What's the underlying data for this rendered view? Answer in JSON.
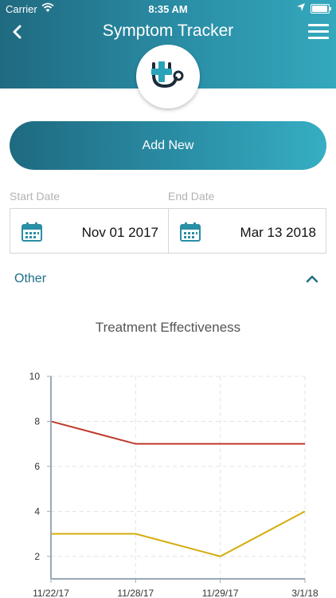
{
  "status_bar": {
    "carrier": "Carrier",
    "time": "8:35 AM"
  },
  "header": {
    "title": "Symptom Tracker"
  },
  "actions": {
    "add_new_label": "Add New"
  },
  "dates": {
    "start_label": "Start Date",
    "start_value": "Nov 01 2017",
    "end_label": "End Date",
    "end_value": "Mar 13 2018"
  },
  "section": {
    "label": "Other"
  },
  "colors": {
    "accent": "#2a8ea6",
    "series_red": "#c0392b",
    "series_yellow": "#d4ac0d"
  },
  "chart_data": {
    "type": "line",
    "title": "Treatment Effectiveness",
    "categories": [
      "11/22/17",
      "11/28/17",
      "11/29/17",
      "3/1/18"
    ],
    "series": [
      {
        "values": [
          8,
          7,
          7,
          7
        ],
        "color": "#c0392b"
      },
      {
        "values": [
          3,
          3,
          2,
          4
        ],
        "color": "#d4ac0d"
      }
    ],
    "yticks": [
      2,
      4,
      6,
      8,
      10
    ],
    "ylim": [
      1,
      10
    ],
    "grid": true
  }
}
